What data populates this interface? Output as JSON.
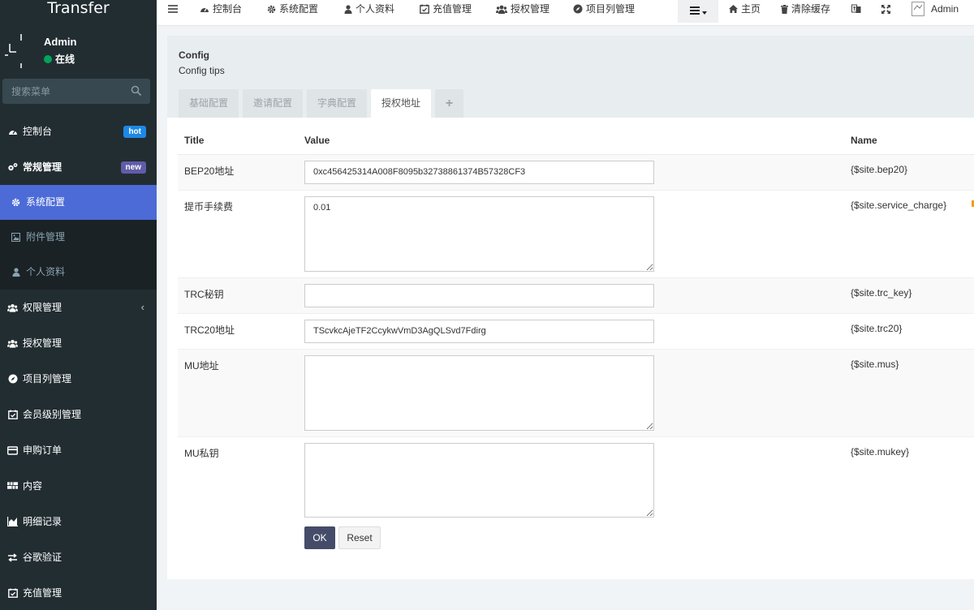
{
  "sidebar": {
    "brand": "Transfer",
    "user": {
      "name": "Admin",
      "status": "在线"
    },
    "search_placeholder": "搜索菜单",
    "items": [
      {
        "label": "控制台",
        "icon": "dashboard-icon",
        "badge": "hot"
      },
      {
        "label": "常规管理",
        "icon": "cogs-icon",
        "badge": "new"
      },
      {
        "label": "系统配置",
        "icon": "gear-icon"
      },
      {
        "label": "附件管理",
        "icon": "image-icon"
      },
      {
        "label": "个人资料",
        "icon": "user-icon"
      },
      {
        "label": "权限管理",
        "icon": "group-icon"
      },
      {
        "label": "授权管理",
        "icon": "group-icon"
      },
      {
        "label": "项目列管理",
        "icon": "compass-icon"
      },
      {
        "label": "会员级别管理",
        "icon": "calendar-check-icon"
      },
      {
        "label": "申购订单",
        "icon": "credit-card-icon"
      },
      {
        "label": "内容",
        "icon": "grid-icon"
      },
      {
        "label": "明细记录",
        "icon": "chart-icon"
      },
      {
        "label": "谷歌验证",
        "icon": "exchange-icon"
      },
      {
        "label": "充值管理",
        "icon": "calendar-check-icon"
      }
    ]
  },
  "navbar": {
    "tabs": [
      {
        "label": "控制台",
        "icon": "dashboard-icon"
      },
      {
        "label": "系统配置",
        "icon": "gear-icon"
      },
      {
        "label": "个人资料",
        "icon": "user-icon"
      },
      {
        "label": "充值管理",
        "icon": "calendar-check-icon"
      },
      {
        "label": "授权管理",
        "icon": "group-icon"
      },
      {
        "label": "项目列管理",
        "icon": "compass-icon"
      }
    ],
    "home": "主页",
    "clear_cache": "清除缓存",
    "admin": "Admin"
  },
  "page": {
    "title": "Config",
    "tips": "Config tips",
    "tabs": [
      "基础配置",
      "邀请配置",
      "字典配置",
      "授权地址",
      "+"
    ],
    "active_tab": "授权地址"
  },
  "table": {
    "headers": {
      "title": "Title",
      "value": "Value",
      "name": "Name"
    },
    "rows": [
      {
        "title": "BEP20地址",
        "value": "0xc456425314A008F8095b32738861374B57328CF3",
        "name": "{$site.bep20}"
      },
      {
        "title": "提币手续费",
        "value": "0.01",
        "name": "{$site.service_charge}"
      },
      {
        "title": "TRC秘钥",
        "value": "",
        "name": "{$site.trc_key}"
      },
      {
        "title": "TRC20地址",
        "value": "TScvkcAjeTF2CcykwVmD3AgQLSvd7Fdirg",
        "name": "{$site.trc20}"
      },
      {
        "title": "MU地址",
        "value": "",
        "name": "{$site.mus}"
      },
      {
        "title": "MU私钥",
        "value": "",
        "name": "{$site.mukey}"
      }
    ]
  },
  "buttons": {
    "ok": "OK",
    "reset": "Reset"
  },
  "colors": {
    "sidebar_bg": "#222d32",
    "active_menu": "#4c6bd6",
    "badge_hot": "#1e88e5",
    "badge_new": "#605ca8",
    "ok_button": "#444c69",
    "online": "#00a65a"
  }
}
